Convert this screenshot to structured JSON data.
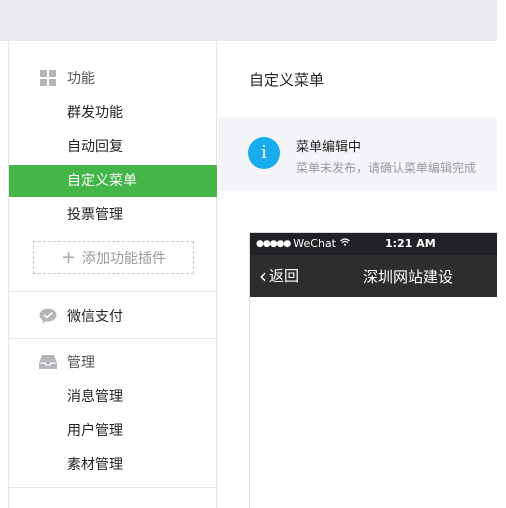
{
  "sidebar": {
    "sections": {
      "function": {
        "title": "功能",
        "icon": "grid-icon"
      },
      "payment": {
        "title": "微信支付",
        "icon": "wechat-pay-icon"
      },
      "manage": {
        "title": "管理",
        "icon": "inbox-icon"
      }
    },
    "function_items": [
      {
        "label": "群发功能"
      },
      {
        "label": "自动回复"
      },
      {
        "label": "自定义菜单",
        "active": true
      },
      {
        "label": "投票管理"
      }
    ],
    "add_plugin_label": "添加功能插件",
    "manage_items": [
      {
        "label": "消息管理"
      },
      {
        "label": "用户管理"
      },
      {
        "label": "素材管理"
      }
    ],
    "accent_color": "#44b549"
  },
  "main": {
    "page_title": "自定义菜单",
    "notice": {
      "title": "菜单编辑中",
      "description": "菜单未发布，请确认菜单编辑完成",
      "icon": "info-icon",
      "icon_color": "#1aabef"
    }
  },
  "phone": {
    "carrier": "WeChat",
    "time": "1:21 AM",
    "back_label": "返回",
    "account_name": "深圳网站建设"
  }
}
